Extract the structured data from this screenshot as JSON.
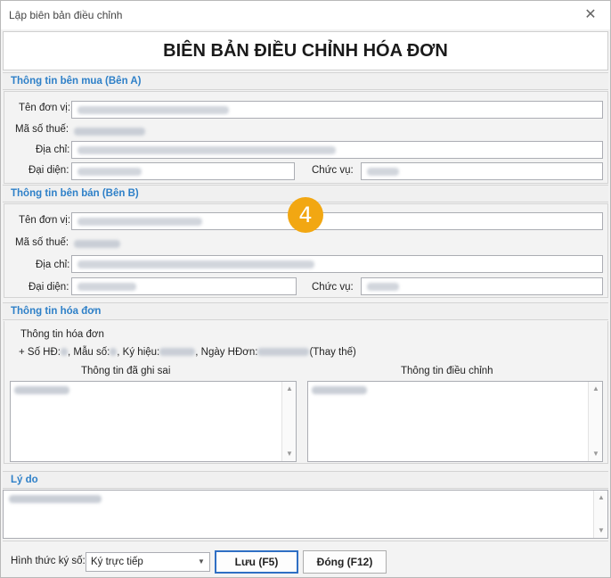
{
  "window": {
    "title": "Lập biên bản điều chỉnh",
    "close_glyph": "✕"
  },
  "document": {
    "title": "BIÊN BẢN ĐIỀU CHỈNH HÓA ĐƠN"
  },
  "buyer": {
    "header": "Thông tin bên mua (Bên A)",
    "labels": {
      "name": "Tên đơn vị:",
      "tax": "Mã số thuế:",
      "address": "Địa chỉ:",
      "rep": "Đại diện:",
      "position": "Chức vụ:"
    }
  },
  "seller": {
    "header": "Thông tin bên bán (Bên B)",
    "labels": {
      "name": "Tên đơn vị:",
      "tax": "Mã số thuế:",
      "address": "Địa chỉ:",
      "rep": "Đại diện:",
      "position": "Chức vụ:"
    }
  },
  "step_badge": "4",
  "invoice": {
    "header": "Thông tin hóa đơn",
    "subtitle": "Thông tin hóa đơn",
    "line_prefix": "+ Số HĐ:",
    "line_form": ", Mẫu số:",
    "line_symbol": ", Ký hiệu:",
    "line_date": ", Ngày HĐơn:",
    "line_suffix": "(Thay thế)",
    "wrong_label": "Thông tin đã ghi sai",
    "adjust_label": "Thông tin điều chỉnh"
  },
  "reason": {
    "header": "Lý do"
  },
  "footer": {
    "sign_label": "Hình thức ký số:",
    "sign_value": "Ký trực tiếp",
    "save_label": "Lưu (F5)",
    "close_label": "Đóng (F12)"
  },
  "colors": {
    "accent": "#2e80c8",
    "badge": "#f2a712",
    "primary_border": "#2f6fc4"
  },
  "icons": {
    "close": "close-icon",
    "dropdown": "chevron-down-icon",
    "scroll_up": "scroll-up-arrow-icon",
    "scroll_down": "scroll-down-arrow-icon"
  }
}
